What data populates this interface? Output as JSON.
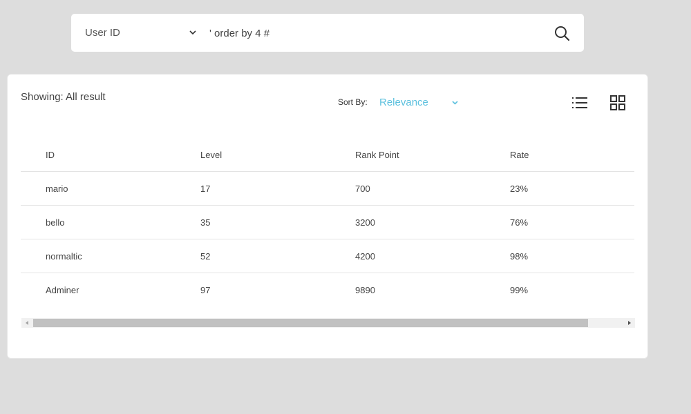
{
  "search": {
    "type_label": "User ID",
    "query": "' order by 4 #",
    "search_icon": "search-icon",
    "dropdown_icon": "chevron-down-icon"
  },
  "results": {
    "showing_text": "Showing: All result",
    "sort_label": "Sort By:",
    "sort_value": "Relevance",
    "sort_color": "#5bc0de",
    "view_icons": [
      "list-icon",
      "grid-icon"
    ]
  },
  "table": {
    "headers": [
      "ID",
      "Level",
      "Rank Point",
      "Rate"
    ],
    "rows": [
      [
        "mario",
        "17",
        "700",
        "23%"
      ],
      [
        "bello",
        "35",
        "3200",
        "76%"
      ],
      [
        "normaltic",
        "52",
        "4200",
        "98%"
      ],
      [
        "Adminer",
        "97",
        "9890",
        "99%"
      ]
    ]
  }
}
